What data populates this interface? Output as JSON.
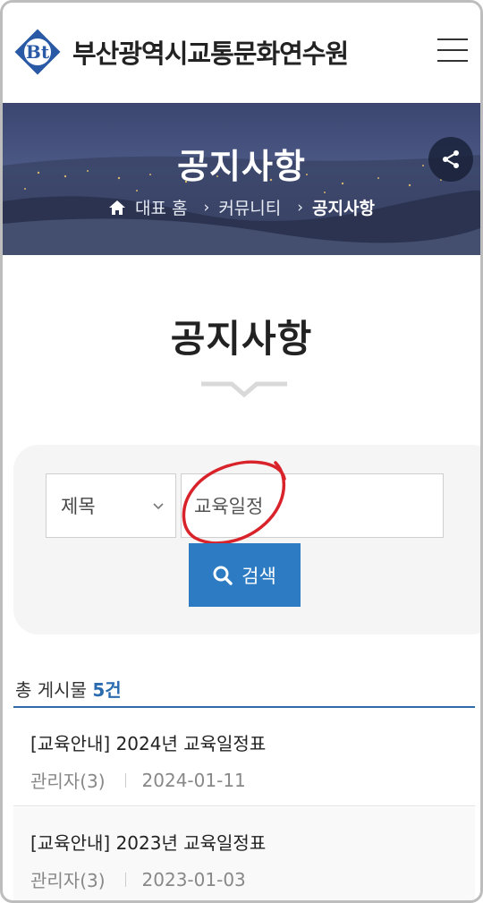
{
  "header": {
    "logo_text": "부산광역시교통문화연수원",
    "logo_mark_text": "Bt",
    "menu_icon": "hamburger-icon"
  },
  "hero": {
    "title": "공지사항",
    "breadcrumb": {
      "home": "대표 홈",
      "community": "커뮤니티",
      "current": "공지사항"
    },
    "share_icon": "share-icon"
  },
  "page": {
    "title": "공지사항"
  },
  "search": {
    "field_select": "제목",
    "query_value": "교육일정",
    "button_label": "검색"
  },
  "results": {
    "count_label": "총 게시물",
    "count_value": "5건",
    "items": [
      {
        "title": "[교육안내] 2024년 교육일정표",
        "author": "관리자(3)",
        "date": "2024-01-11"
      },
      {
        "title": "[교육안내] 2023년 교육일정표",
        "author": "관리자(3)",
        "date": "2023-01-03"
      }
    ]
  },
  "colors": {
    "accent_blue": "#2c7bc3",
    "count_blue": "#2a6bb0",
    "hero_dark": "#2a3450",
    "annotation_red": "#d8232a"
  }
}
